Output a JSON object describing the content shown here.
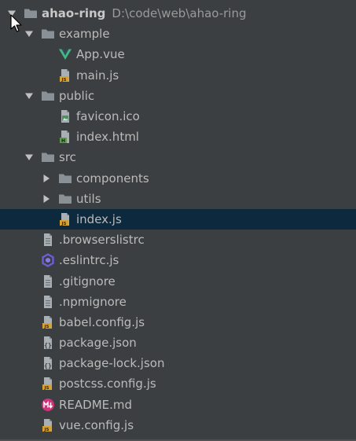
{
  "tree": {
    "rows": [
      {
        "name": "project-root",
        "indent": 0,
        "toggle": "open",
        "icon": "folder-icon",
        "label": "ahao-ring",
        "path": "D:\\code\\web\\ahao-ring",
        "bold": true
      },
      {
        "name": "folder-example",
        "indent": 1,
        "toggle": "open",
        "icon": "folder-icon",
        "label": "example"
      },
      {
        "name": "file-app-vue",
        "indent": 2,
        "toggle": "none",
        "icon": "vue-file-icon",
        "label": "App.vue"
      },
      {
        "name": "file-main-js",
        "indent": 2,
        "toggle": "none",
        "icon": "js-file-icon",
        "label": "main.js"
      },
      {
        "name": "folder-public",
        "indent": 1,
        "toggle": "open",
        "icon": "folder-icon",
        "label": "public"
      },
      {
        "name": "file-favicon",
        "indent": 2,
        "toggle": "none",
        "icon": "image-file-icon",
        "label": "favicon.ico"
      },
      {
        "name": "file-index-html",
        "indent": 2,
        "toggle": "none",
        "icon": "html-file-icon",
        "label": "index.html"
      },
      {
        "name": "folder-src",
        "indent": 1,
        "toggle": "open",
        "icon": "folder-icon",
        "label": "src"
      },
      {
        "name": "folder-components",
        "indent": 2,
        "toggle": "closed",
        "icon": "folder-icon",
        "label": "components"
      },
      {
        "name": "folder-utils",
        "indent": 2,
        "toggle": "closed",
        "icon": "folder-icon",
        "label": "utils"
      },
      {
        "name": "file-src-index-js",
        "indent": 2,
        "toggle": "none",
        "icon": "js-file-icon",
        "label": "index.js",
        "selected": true
      },
      {
        "name": "file-browserslistrc",
        "indent": 1,
        "toggle": "none",
        "icon": "text-file-icon",
        "label": ".browserslistrc"
      },
      {
        "name": "file-eslintrc",
        "indent": 1,
        "toggle": "none",
        "icon": "eslint-icon",
        "label": ".eslintrc.js"
      },
      {
        "name": "file-gitignore",
        "indent": 1,
        "toggle": "none",
        "icon": "text-file-icon",
        "label": ".gitignore"
      },
      {
        "name": "file-npmignore",
        "indent": 1,
        "toggle": "none",
        "icon": "text-file-icon",
        "label": ".npmignore"
      },
      {
        "name": "file-babel-config",
        "indent": 1,
        "toggle": "none",
        "icon": "js-file-icon",
        "label": "babel.config.js"
      },
      {
        "name": "file-package-json",
        "indent": 1,
        "toggle": "none",
        "icon": "json-file-icon",
        "label": "package.json"
      },
      {
        "name": "file-package-lock-json",
        "indent": 1,
        "toggle": "none",
        "icon": "json-file-icon",
        "label": "package-lock.json"
      },
      {
        "name": "file-postcss-config",
        "indent": 1,
        "toggle": "none",
        "icon": "js-file-icon",
        "label": "postcss.config.js"
      },
      {
        "name": "file-readme",
        "indent": 1,
        "toggle": "none",
        "icon": "markdown-file-icon",
        "label": "README.md"
      },
      {
        "name": "file-vue-config",
        "indent": 1,
        "toggle": "none",
        "icon": "js-file-icon",
        "label": "vue.config.js"
      }
    ]
  },
  "colors": {
    "background": "#3c3f41",
    "selection": "#0d293e",
    "folder": "#8a9196",
    "vue_green": "#41b883",
    "js_yellow": "#d6a130",
    "html_green": "#5aa046",
    "eslint_purple": "#6c5dd3",
    "markdown_pink": "#d1337a"
  }
}
